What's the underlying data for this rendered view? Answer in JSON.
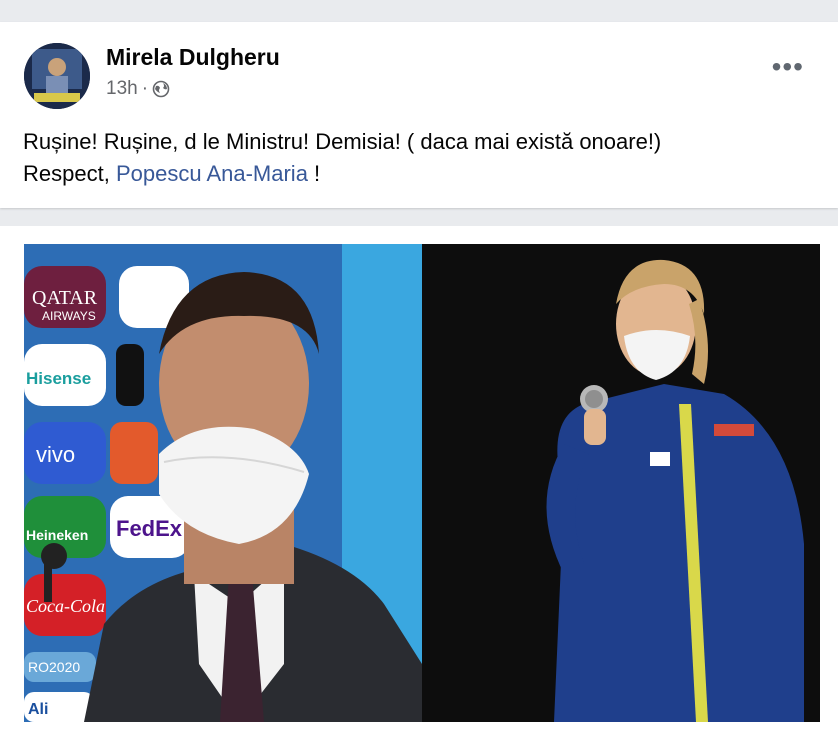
{
  "post": {
    "author": "Mirela Dulgheru",
    "time": "13h",
    "separator": "·",
    "privacy_icon": "globe-icon",
    "more_icon": "more-options-icon",
    "more_label": "•••",
    "text_line1": "Rușine! Rușine, d le Ministru! Demisia! ( daca mai există onoare!)",
    "text_line2_prefix": "Respect, ",
    "mention": "Popescu Ana-Maria",
    "text_line2_suffix": " !"
  },
  "photo": {
    "left_board_logos": [
      "QATAR",
      "AIRWAYS",
      "Hisense",
      "vivo",
      "FedEx",
      "Heineken",
      "Coca-Cola",
      "RO2020",
      "Ali"
    ],
    "colors": {
      "mention": "#385898",
      "board_blue": "#2d6db5",
      "jacket_blue": "#1f3f8c",
      "stripe_yellow": "#d9d84a"
    }
  }
}
